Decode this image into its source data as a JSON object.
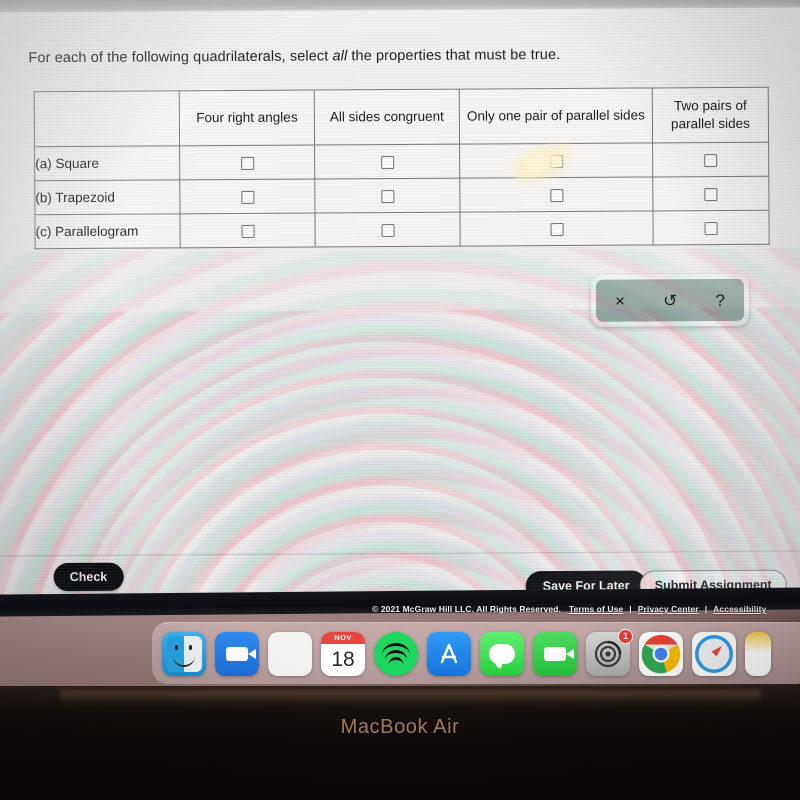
{
  "question": {
    "prompt_before": "For each of the following quadrilaterals, select ",
    "prompt_emphasis": "all",
    "prompt_after": " the properties that must be true."
  },
  "table": {
    "headers": [
      "",
      "Four right angles",
      "All sides congruent",
      "Only one pair of parallel sides",
      "Two pairs of parallel sides"
    ],
    "rows": [
      {
        "label": "(a) Square",
        "checkboxes": [
          false,
          false,
          false,
          false
        ]
      },
      {
        "label": "(b) Trapezoid",
        "checkboxes": [
          false,
          false,
          false,
          false
        ]
      },
      {
        "label": "(c) Parallelogram",
        "checkboxes": [
          false,
          false,
          false,
          false
        ]
      }
    ]
  },
  "toolbox": {
    "clear_label": "×",
    "undo_label": "↺",
    "help_label": "?"
  },
  "actions": {
    "check_label": "Check",
    "save_label": "Save For Later",
    "submit_label": "Submit Assignment"
  },
  "footer": {
    "copyright": "© 2021 McGraw Hill LLC. All Rights Reserved.",
    "terms": "Terms of Use",
    "privacy": "Privacy Center",
    "accessibility": "Accessibility",
    "separator": "|"
  },
  "dock": {
    "items": [
      {
        "name": "finder",
        "label": "Finder"
      },
      {
        "name": "zoom",
        "label": "Zoom"
      },
      {
        "name": "launchpad",
        "label": "Launchpad"
      },
      {
        "name": "calendar",
        "label": "Calendar",
        "month": "NOV",
        "day": "18"
      },
      {
        "name": "spotify",
        "label": "Spotify"
      },
      {
        "name": "app-store",
        "label": "App Store"
      },
      {
        "name": "messages",
        "label": "Messages"
      },
      {
        "name": "facetime",
        "label": "FaceTime"
      },
      {
        "name": "system-preferences",
        "label": "System Preferences",
        "badge": "1"
      },
      {
        "name": "google-chrome",
        "label": "Google Chrome"
      },
      {
        "name": "safari",
        "label": "Safari"
      },
      {
        "name": "partial-app",
        "label": ""
      }
    ]
  },
  "device": {
    "model_label": "MacBook Air"
  },
  "colors": {
    "accent_dark": "#101014",
    "calendar_red": "#e8453c",
    "spotify_green": "#1ed760",
    "badge_red": "#ea3b2e",
    "tool_panel": "#9aa9a4",
    "bezel_text": "#a88058"
  }
}
